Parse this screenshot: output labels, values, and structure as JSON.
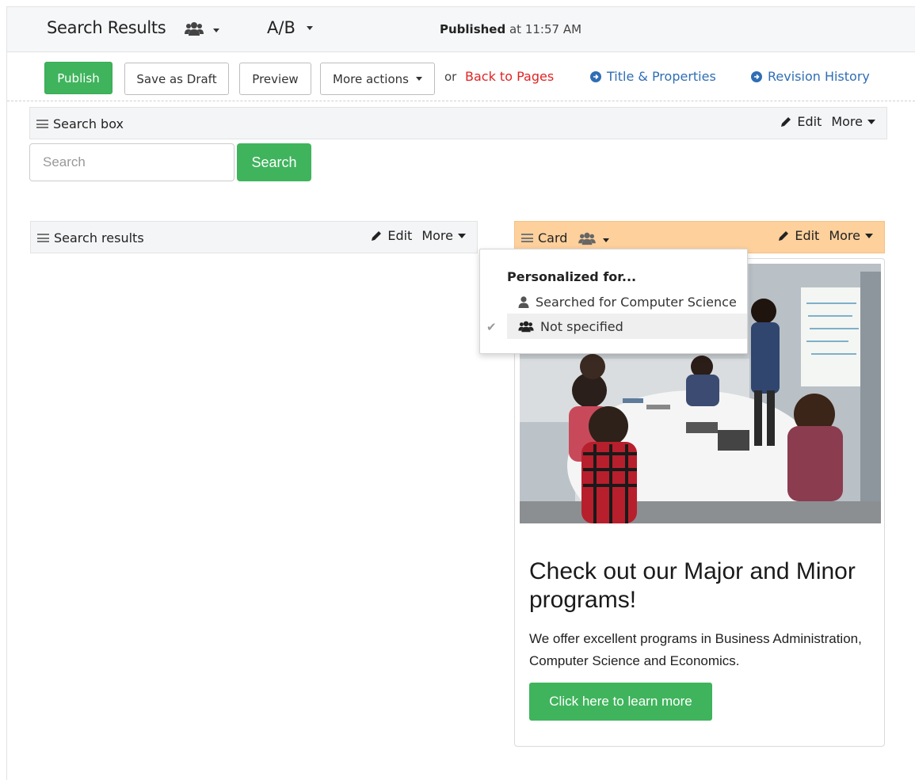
{
  "header": {
    "title": "Search Results",
    "persona_icon": "users-icon",
    "ab_label": "A/B",
    "status_bold": "Published",
    "status_rest": " at 11:57 AM"
  },
  "toolbar": {
    "publish": "Publish",
    "save_draft": "Save as Draft",
    "preview": "Preview",
    "more_actions": "More actions",
    "or_text": "or",
    "back_to_pages": "Back to Pages",
    "title_properties": "Title & Properties",
    "revision_history": "Revision History"
  },
  "search_box_section": {
    "label": "Search box",
    "edit": "Edit",
    "more": "More",
    "input_placeholder": "Search",
    "button": "Search"
  },
  "search_results_section": {
    "label": "Search results",
    "edit": "Edit",
    "more": "More"
  },
  "card_section": {
    "label": "Card",
    "edit": "Edit",
    "more": "More",
    "highlight_color": "#fdd09c"
  },
  "personalization_menu": {
    "heading": "Personalized for...",
    "items": [
      {
        "label": "Searched for Computer Science",
        "icon": "user-icon",
        "selected": false
      },
      {
        "label": "Not specified",
        "icon": "users-icon",
        "selected": true
      }
    ]
  },
  "card": {
    "image": "group-meeting-photo",
    "title": "Check out our Major and Minor programs!",
    "text": "We offer excellent programs in Business Administration, Computer Science and Economics.",
    "button": "Click here to learn more"
  },
  "colors": {
    "primary_green": "#3fb45c",
    "link_blue": "#2f6eb5",
    "back_red": "#e02424"
  }
}
